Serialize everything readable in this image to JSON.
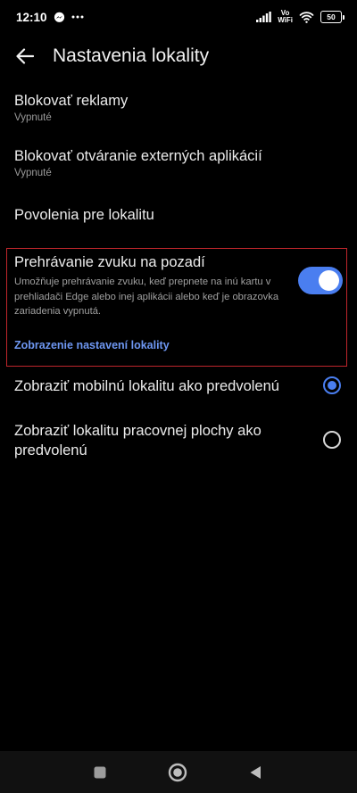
{
  "status_bar": {
    "time": "12:10",
    "vowifi_top": "Vo",
    "vowifi_bottom": "WiFi",
    "battery": "50"
  },
  "header": {
    "title": "Nastavenia lokality"
  },
  "settings": {
    "block_ads": {
      "title": "Blokovať reklamy",
      "subtitle": "Vypnuté"
    },
    "block_external_apps": {
      "title": "Blokovať otváranie externých aplikácií",
      "subtitle": "Vypnuté"
    },
    "site_permissions": {
      "title": "Povolenia pre lokalitu"
    },
    "background_audio": {
      "title": "Prehrávanie zvuku na pozadí",
      "description": "Umožňuje prehrávanie zvuku, keď prepnete na inú kartu v prehliadači Edge alebo inej aplikácii alebo keď je obrazovka zariadenia vypnutá.",
      "enabled": true,
      "link": "Zobrazenie nastavení lokality"
    },
    "site_mode": {
      "options": [
        {
          "label": "Zobraziť mobilnú lokalitu ako predvolenú",
          "selected": true
        },
        {
          "label": "Zobraziť lokalitu pracovnej plochy ako predvolenú",
          "selected": false
        }
      ]
    }
  },
  "colors": {
    "accent": "#4a7ef0",
    "link": "#6e97f2",
    "highlight_border": "#c0262c",
    "background": "#000000"
  },
  "icons": {
    "status": [
      "messenger-icon",
      "more-icon",
      "signal-icon",
      "wifi-icon",
      "battery-icon"
    ],
    "header": "back-arrow-icon",
    "nav": [
      "recents-square-icon",
      "home-circle-icon",
      "back-triangle-icon"
    ]
  }
}
